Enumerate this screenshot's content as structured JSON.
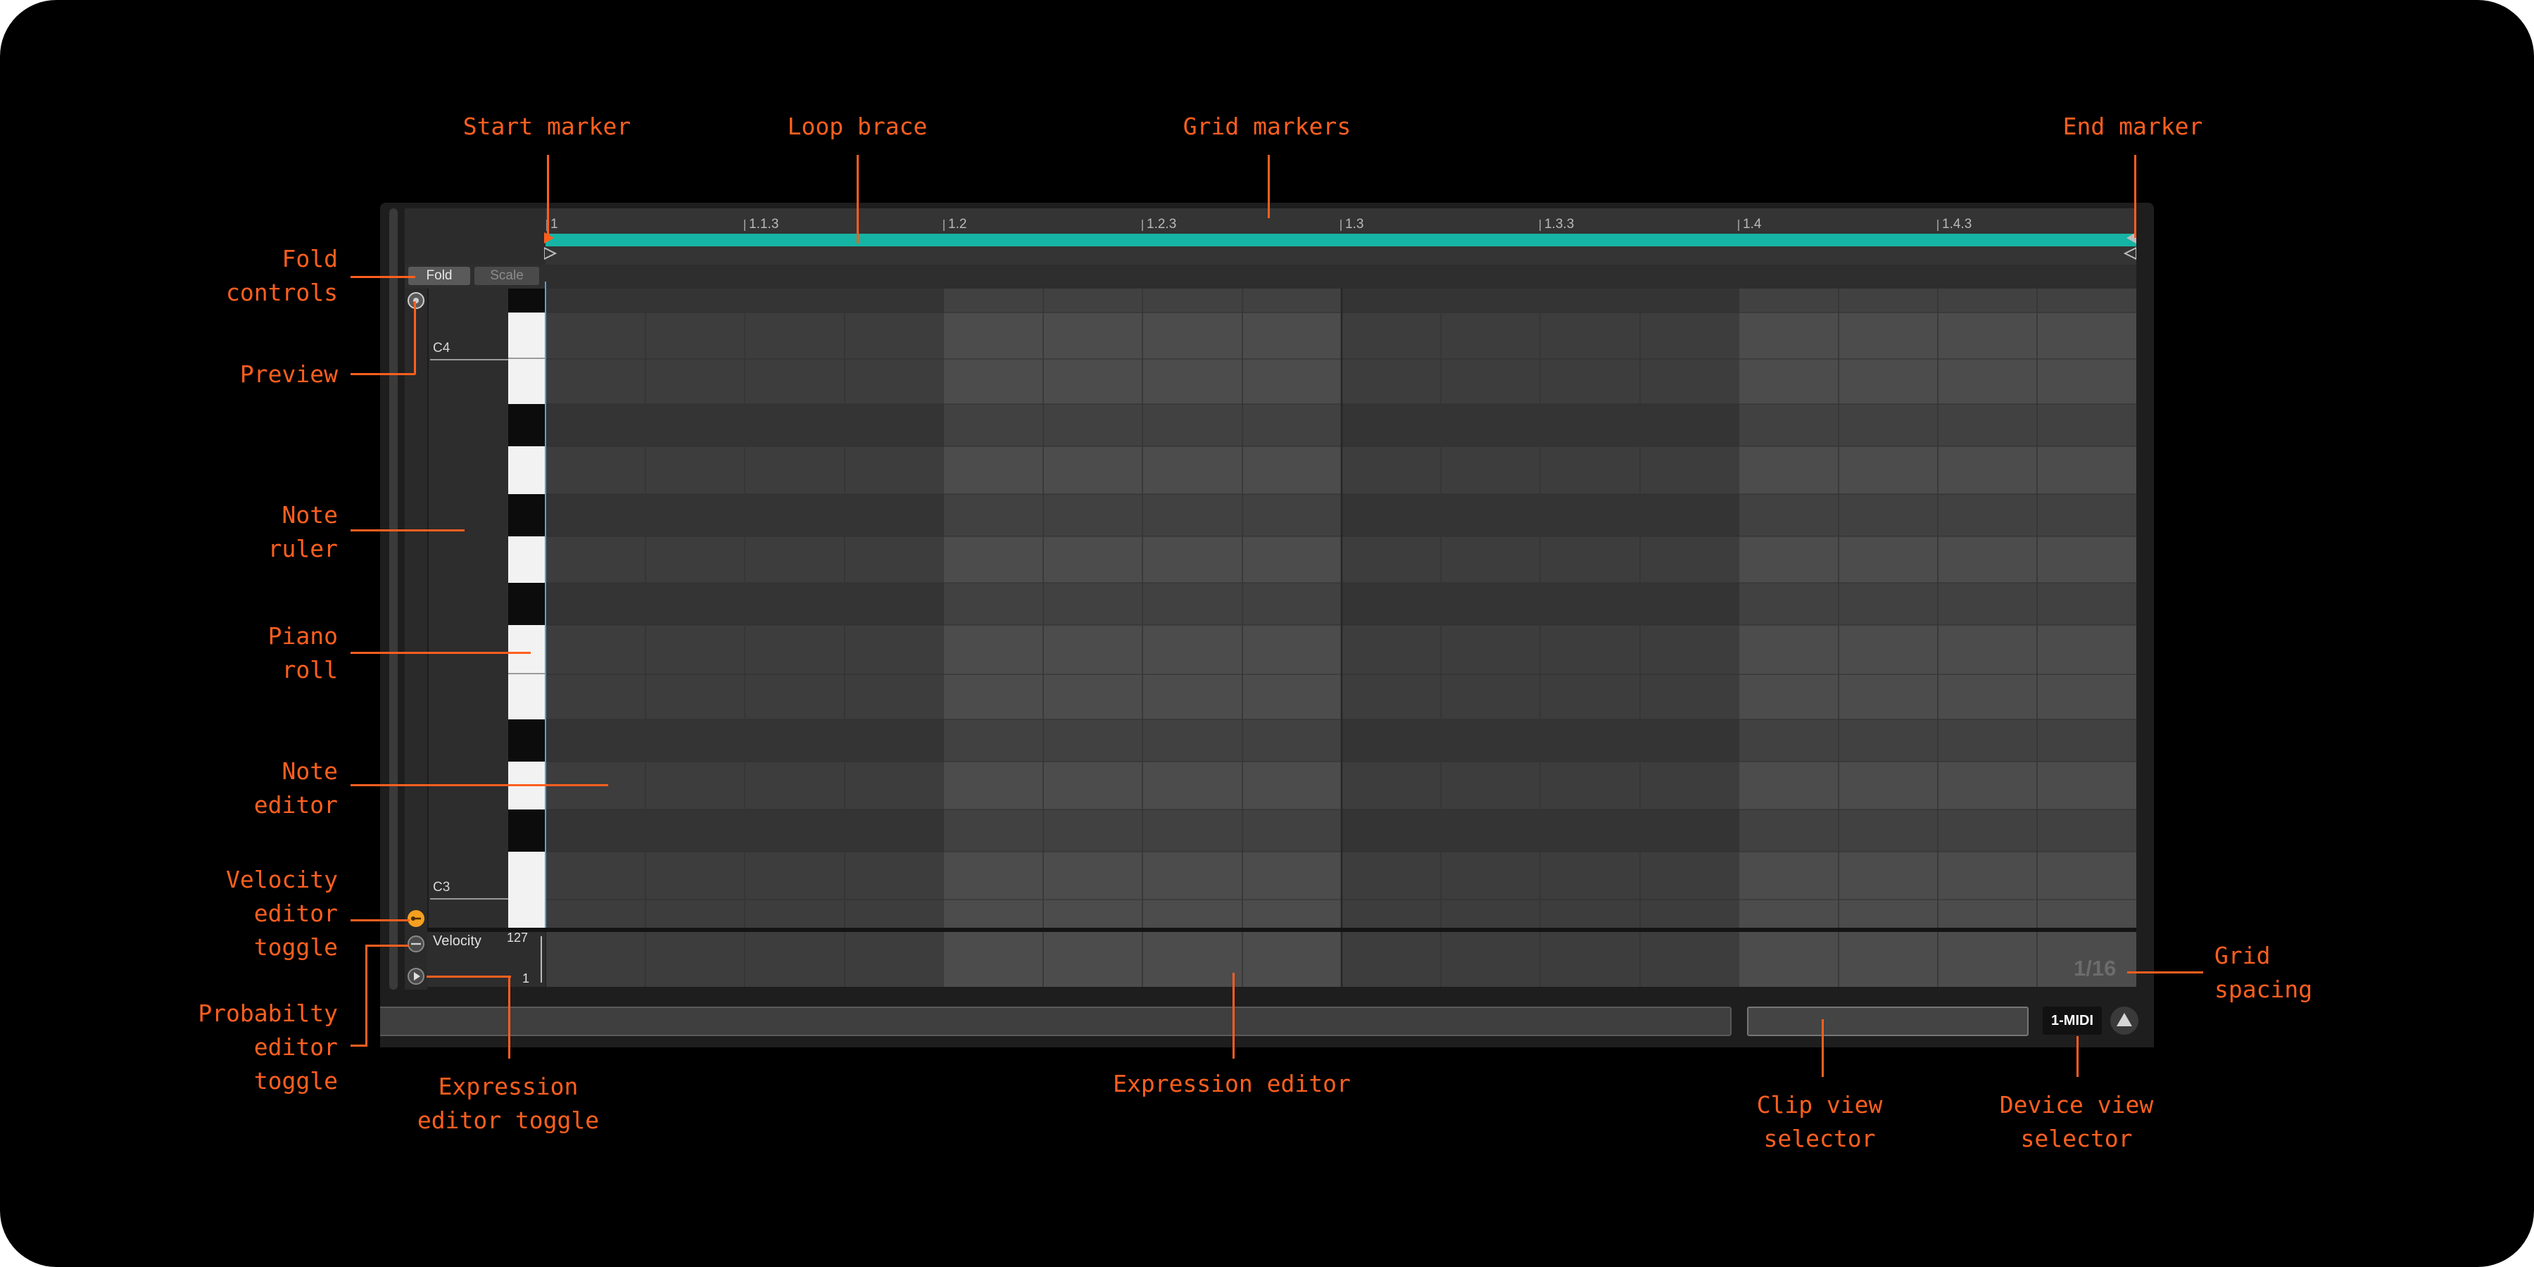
{
  "annotations": {
    "start_marker": "Start marker",
    "loop_brace": "Loop brace",
    "grid_markers": "Grid markers",
    "end_marker": "End marker",
    "fold_controls": "Fold\ncontrols",
    "preview": "Preview",
    "note_ruler": "Note\nruler",
    "piano_roll": "Piano\nroll",
    "note_editor": "Note\neditor",
    "velocity_editor_toggle": "Velocity\neditor\ntoggle",
    "probability_editor_toggle": "Probabilty\neditor\ntoggle",
    "expression_editor_toggle": "Expression\neditor toggle",
    "expression_editor": "Expression editor",
    "clip_view_selector": "Clip view\nselector",
    "device_view_selector": "Device view\nselector",
    "grid_spacing": "Grid\nspacing"
  },
  "editor": {
    "ruler_ticks": [
      "1",
      "1.1.3",
      "1.2",
      "1.2.3",
      "1.3",
      "1.3.3",
      "1.4",
      "1.4.3"
    ],
    "fold_label": "Fold",
    "scale_label": "Scale",
    "note_labels": {
      "high": "C4",
      "low": "C3"
    },
    "velocity_label": "Velocity",
    "velocity_max": "127",
    "velocity_min": "1",
    "grid_spacing": "1/16",
    "track_name": "1-MIDI"
  },
  "colors": {
    "accent": "#ff5f1f",
    "loop_brace": "#16b4a4",
    "panel": "#2b2b2b",
    "grid_light": "#4a4a4a",
    "grid_dark": "#3b3b3b"
  },
  "icons": {
    "preview": "headphones-icon",
    "velocity_toggle": "velocity-toggle-icon",
    "probability_toggle": "probability-toggle-icon",
    "expression_toggle": "play-triangle-icon",
    "device_view": "triangle-icon"
  }
}
